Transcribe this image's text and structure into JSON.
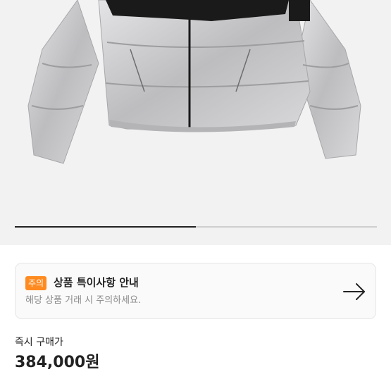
{
  "product_image": {
    "alt": "silver puffer jacket",
    "colors": {
      "background": "#f2f2f2",
      "body": "#c9c9cb",
      "shade": "#9d9d9f",
      "yoke": "#1a1a1a"
    }
  },
  "gallery": {
    "current_fraction": 0.5
  },
  "notice": {
    "badge": "주의",
    "title": "상품 특이사항 안내",
    "description": "해당 상품 거래 시 주의하세요.",
    "arrow_icon": "arrow-right-icon",
    "badge_color": "#ff8a1f"
  },
  "purchase": {
    "label": "즉시 구매가",
    "price": "384,000원"
  }
}
